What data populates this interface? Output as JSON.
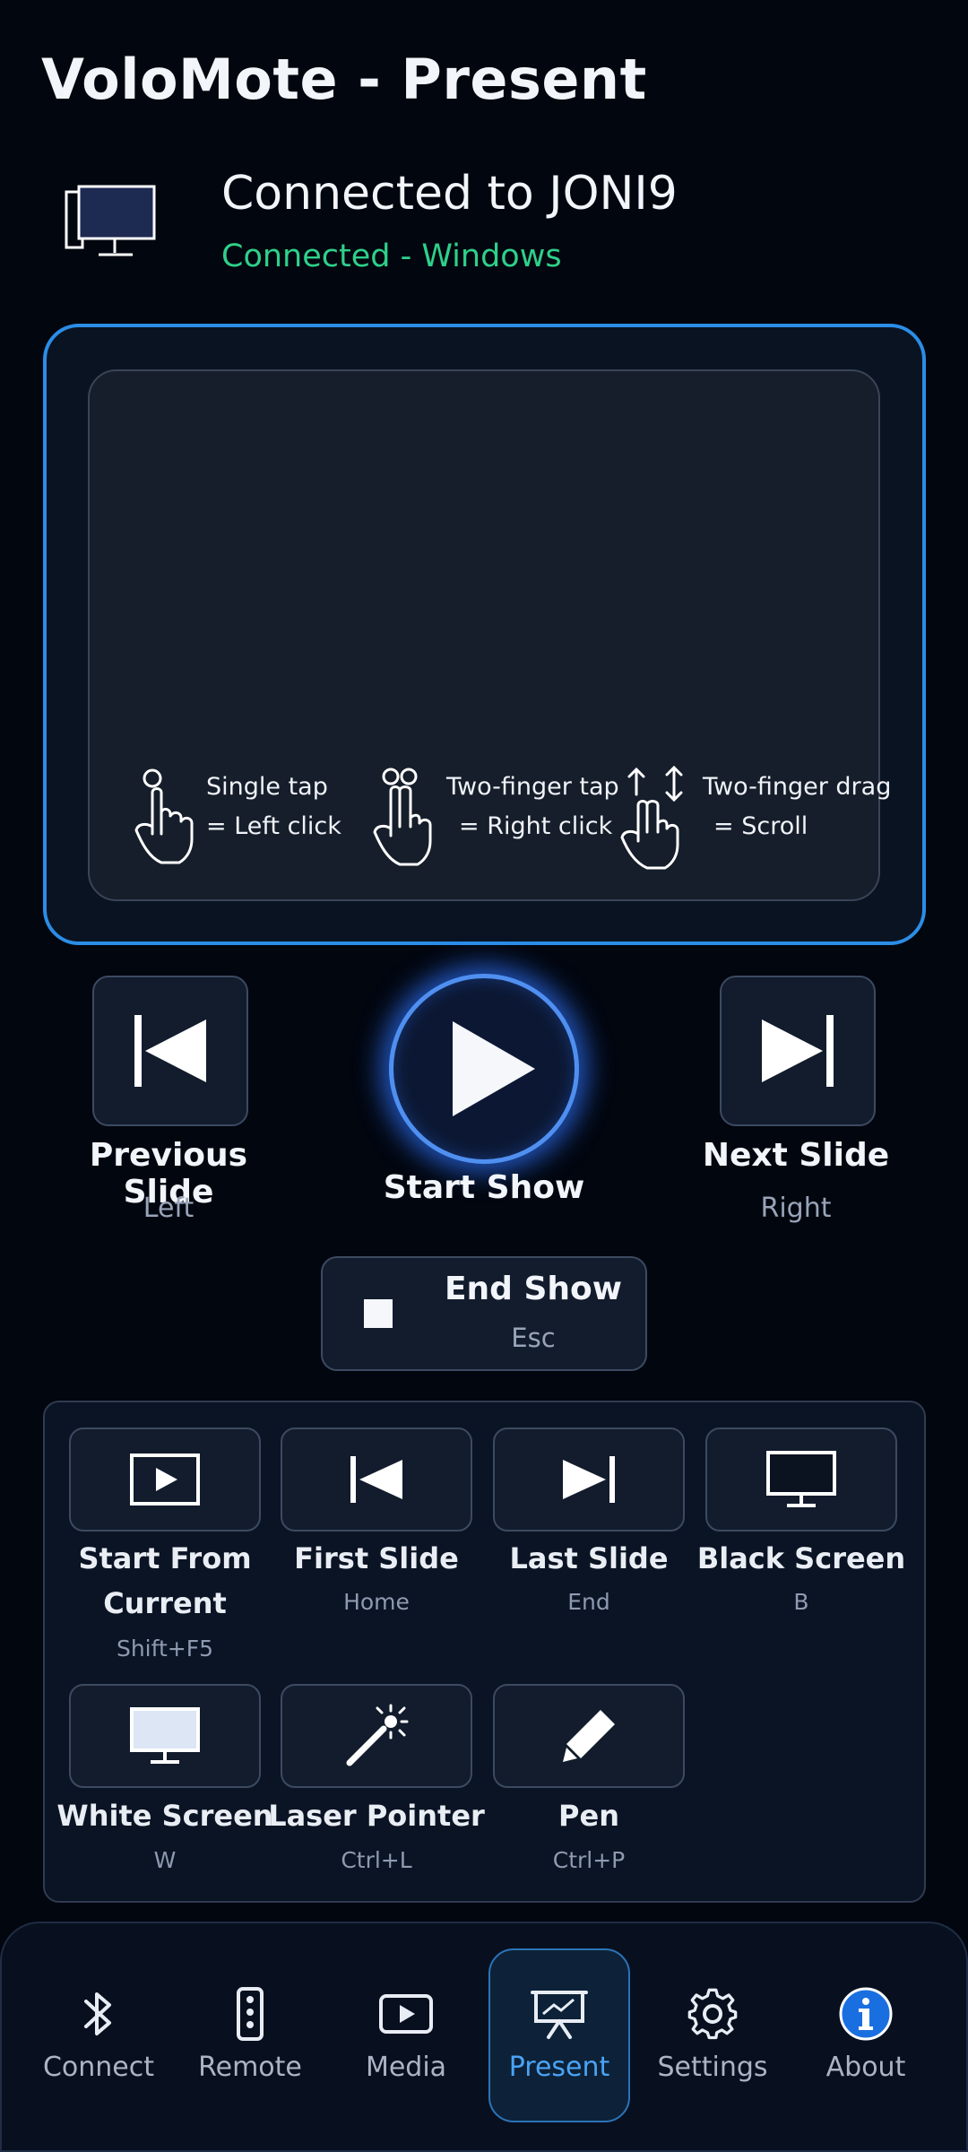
{
  "app": {
    "title": "VoloMote - Present"
  },
  "connection": {
    "title": "Connected to JONI9",
    "status": "Connected - Windows",
    "status_color": "#2fd08a"
  },
  "touchpad": {
    "hints": [
      {
        "icon": "single-tap-icon",
        "line1": "Single tap",
        "line2": "= Left click"
      },
      {
        "icon": "two-finger-tap-icon",
        "line1": "Two-finger tap",
        "line2": "= Right click"
      },
      {
        "icon": "two-finger-drag-icon",
        "line1": "Two-finger drag",
        "line2": "= Scroll"
      }
    ]
  },
  "controls": {
    "previous": {
      "label": "Previous Slide",
      "key": "Left"
    },
    "start": {
      "label": "Start Show"
    },
    "next": {
      "label": "Next Slide",
      "key": "Right"
    },
    "end": {
      "label": "End Show",
      "key": "Esc"
    }
  },
  "shortcuts": [
    {
      "label_line1": "Start From",
      "label_line2": "Current",
      "key": "Shift+F5",
      "icon": "screen-play-icon"
    },
    {
      "label_line1": "First Slide",
      "key": "Home",
      "icon": "first-slide-icon"
    },
    {
      "label_line1": "Last Slide",
      "key": "End",
      "icon": "last-slide-icon"
    },
    {
      "label_line1": "Black Screen",
      "key": "B",
      "icon": "black-monitor-icon"
    },
    {
      "label_line1": "White Screen",
      "key": "W",
      "icon": "white-monitor-icon"
    },
    {
      "label_line1": "Laser Pointer",
      "key": "Ctrl+L",
      "icon": "laser-wand-icon"
    },
    {
      "label_line1": "Pen",
      "key": "Ctrl+P",
      "icon": "pen-icon"
    }
  ],
  "nav": {
    "items": [
      {
        "label": "Connect",
        "icon": "bluetooth-icon"
      },
      {
        "label": "Remote",
        "icon": "remote-icon"
      },
      {
        "label": "Media",
        "icon": "media-play-icon"
      },
      {
        "label": "Present",
        "icon": "presentation-icon"
      },
      {
        "label": "Settings",
        "icon": "gear-icon"
      },
      {
        "label": "About",
        "icon": "info-icon"
      }
    ],
    "active_index": 3,
    "active_color": "#4aa3f5"
  },
  "colors": {
    "accent": "#2b8de6",
    "background": "#02060f"
  }
}
